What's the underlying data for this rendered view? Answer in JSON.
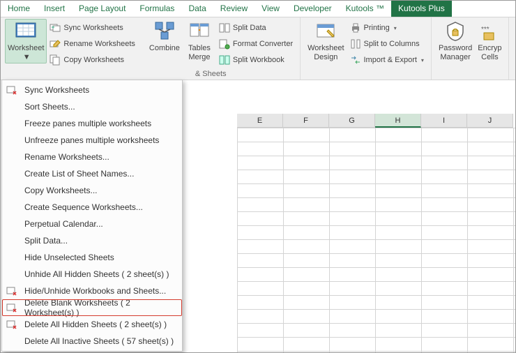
{
  "tabs": [
    "Home",
    "Insert",
    "Page Layout",
    "Formulas",
    "Data",
    "Review",
    "View",
    "Developer",
    "Kutools ™",
    "Kutools Plus"
  ],
  "active_tab_index": 9,
  "ribbon": {
    "worksheet_big": "Worksheet",
    "sync": "Sync Worksheets",
    "rename": "Rename Worksheets",
    "copy": "Copy Worksheets",
    "combine": "Combine",
    "tables_merge": "Tables\nMerge",
    "split_data": "Split Data",
    "format_conv": "Format Converter",
    "split_wb": "Split Workbook",
    "ws_design": "Worksheet\nDesign",
    "printing": "Printing",
    "split_cols": "Split to Columns",
    "import_export": "Import & Export",
    "pwd_mgr": "Password\nManager",
    "encrypt": "Encryp\nCells",
    "group_label_sheets": "& Sheets"
  },
  "menu_items": [
    {
      "label": "Sync Worksheets",
      "icon": true
    },
    {
      "label": "Sort Sheets...",
      "icon": false
    },
    {
      "label": "Freeze panes multiple worksheets",
      "icon": false
    },
    {
      "label": "Unfreeze panes multiple worksheets",
      "icon": false
    },
    {
      "label": "Rename Worksheets...",
      "icon": false
    },
    {
      "label": "Create List of Sheet Names...",
      "icon": false
    },
    {
      "label": "Copy Worksheets...",
      "icon": false
    },
    {
      "label": "Create Sequence Worksheets...",
      "icon": false
    },
    {
      "label": "Perpetual Calendar...",
      "icon": false
    },
    {
      "label": "Split Data...",
      "icon": false
    },
    {
      "label": "Hide Unselected Sheets",
      "icon": false
    },
    {
      "label": "Unhide All Hidden Sheets ( 2 sheet(s) )",
      "icon": false
    },
    {
      "label": "Hide/Unhide Workbooks and Sheets...",
      "icon": true
    },
    {
      "label": "Delete Blank Worksheets ( 2 Worksheet(s) )",
      "icon": true,
      "highlight": true
    },
    {
      "label": "Delete All Hidden Sheets ( 2 sheet(s) )",
      "icon": true
    },
    {
      "label": "Delete All Inactive Sheets ( 57 sheet(s) )",
      "icon": false
    }
  ],
  "columns": [
    "E",
    "F",
    "G",
    "H",
    "I",
    "J"
  ],
  "selected_col": "H"
}
